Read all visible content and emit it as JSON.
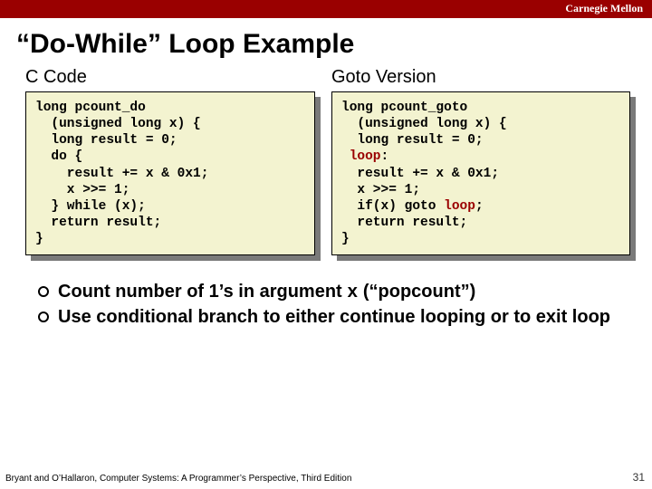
{
  "brand": "Carnegie Mellon",
  "title": "“Do-While” Loop Example",
  "left": {
    "heading": "C Code",
    "lines": [
      {
        "t": "long pcount_do"
      },
      {
        "t": "  (unsigned long x) {"
      },
      {
        "t": "  long result = 0;"
      },
      {
        "t": "  do {"
      },
      {
        "t": "    result += x & 0x1;"
      },
      {
        "t": "    x >>= 1;"
      },
      {
        "t": "  } while (x);"
      },
      {
        "t": "  return result;"
      },
      {
        "t": "}"
      }
    ]
  },
  "right": {
    "heading": "Goto Version",
    "lines": [
      {
        "t": "long pcount_goto"
      },
      {
        "t": "  (unsigned long x) {"
      },
      {
        "t": "  long result = 0;"
      },
      {
        "t": " loop:",
        "kw_after": "loop"
      },
      {
        "t": "  result += x & 0x1;"
      },
      {
        "t": "  x >>= 1;"
      },
      {
        "t": "  if(x) goto ",
        "kw_inline": "loop",
        "suffix": ";"
      },
      {
        "t": "  return result;"
      },
      {
        "t": "}"
      }
    ]
  },
  "bullets": [
    {
      "pre": "Count number of 1’s in argument ",
      "mono": "x",
      "post": " (“popcount”)"
    },
    {
      "pre": "Use conditional branch to either continue looping or to exit loop"
    }
  ],
  "footer": "Bryant and O’Hallaron, Computer Systems: A Programmer’s Perspective, Third Edition",
  "page": "31"
}
